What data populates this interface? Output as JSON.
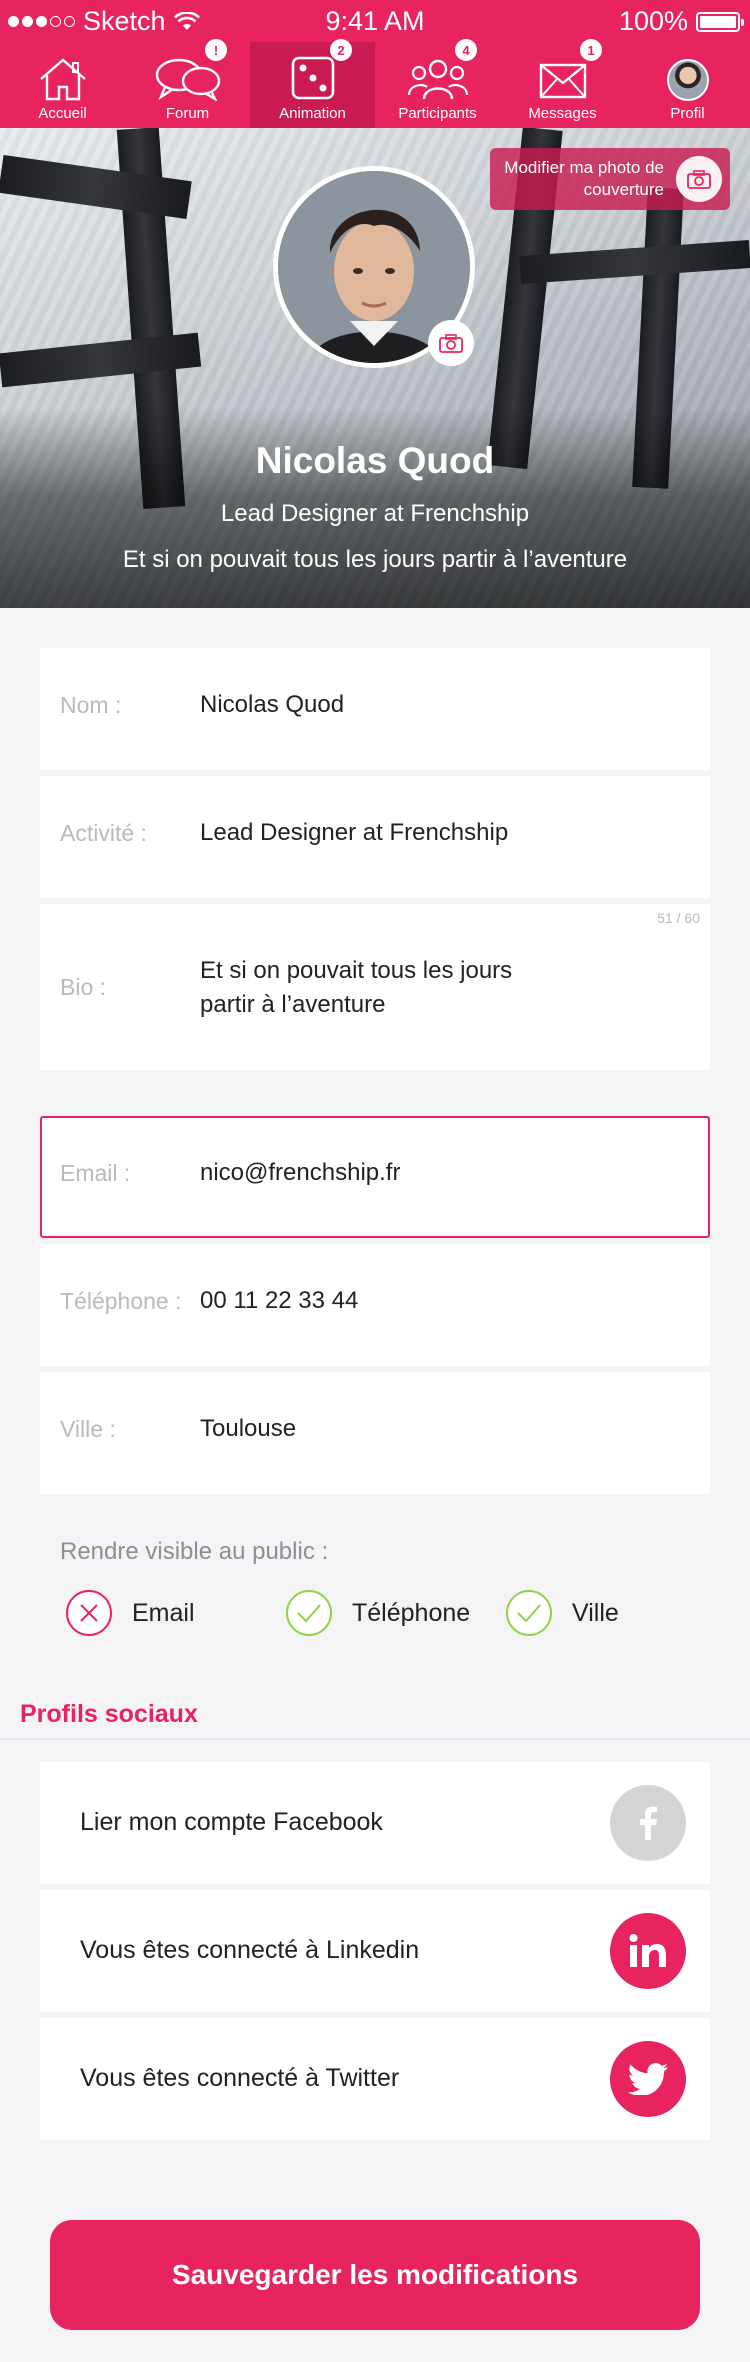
{
  "status_bar": {
    "carrier": "Sketch",
    "time": "9:41 AM",
    "battery": "100%"
  },
  "tabs": [
    {
      "label": "Accueil",
      "icon": "home-icon",
      "badge": ""
    },
    {
      "label": "Forum",
      "icon": "chat-bubbles-icon",
      "badge": "!"
    },
    {
      "label": "Animation",
      "icon": "dice-icon",
      "badge": "2"
    },
    {
      "label": "Participants",
      "icon": "people-icon",
      "badge": "4"
    },
    {
      "label": "Messages",
      "icon": "envelope-icon",
      "badge": "1"
    },
    {
      "label": "Profil",
      "icon": "avatar",
      "badge": ""
    }
  ],
  "cover": {
    "change_cover_label": "Modifier ma photo de couverture",
    "name": "Nicolas Quod",
    "job": "Lead Designer at Frenchship",
    "bio": "Et si on pouvait tous les jours partir à l’aventure"
  },
  "form": {
    "nom": {
      "label": "Nom :",
      "value": "Nicolas Quod"
    },
    "activite": {
      "label": "Activité :",
      "value": "Lead Designer at Frenchship"
    },
    "bio": {
      "label": "Bio :",
      "value": "Et si on pouvait tous les jours partir à l’aventure",
      "counter": "51 / 60"
    },
    "email": {
      "label": "Email :",
      "value": "nico@frenchship.fr"
    },
    "telephone": {
      "label": "Téléphone :",
      "value": "00 11 22 33 44"
    },
    "ville": {
      "label": "Ville :",
      "value": "Toulouse"
    }
  },
  "visibility": {
    "title": "Rendre visible au public :",
    "options": [
      {
        "label": "Email",
        "checked": false
      },
      {
        "label": "Téléphone",
        "checked": true
      },
      {
        "label": "Ville",
        "checked": true
      }
    ]
  },
  "social": {
    "title": "Profils sociaux",
    "items": [
      {
        "label": "Lier mon compte Facebook",
        "icon": "facebook-icon",
        "connected": false
      },
      {
        "label": "Vous êtes connecté à Linkedin",
        "icon": "linkedin-icon",
        "connected": true
      },
      {
        "label": "Vous êtes connecté à Twitter",
        "icon": "twitter-icon",
        "connected": true
      }
    ]
  },
  "save_label": "Sauvegarder les modifications",
  "colors": {
    "accent": "#e8245f",
    "checked": "#8fd346",
    "disconnected": "#d4d4d4"
  }
}
